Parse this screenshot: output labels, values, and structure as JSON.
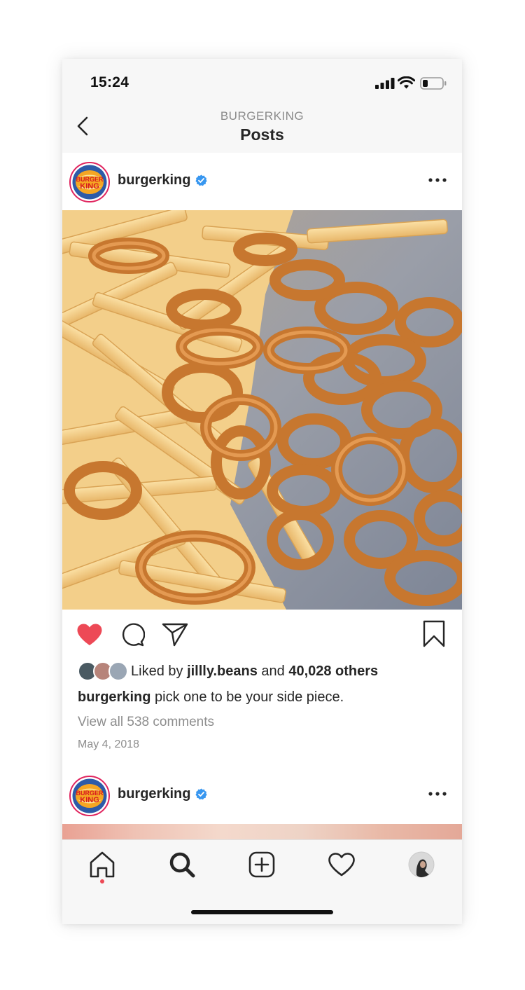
{
  "status_bar": {
    "time": "15:24"
  },
  "nav": {
    "subtitle": "BURGERKING",
    "title": "Posts"
  },
  "post1": {
    "username": "burgerking",
    "verified": true,
    "liked": true,
    "likes": {
      "liked_by_prefix": "Liked by ",
      "liked_by_user": "jillly.beans",
      "and": " and ",
      "others": "40,028 others"
    },
    "caption": {
      "username": "burgerking",
      "text": " pick one to be your side piece."
    },
    "comments_link": "View all 538 comments",
    "date": "May 4, 2018",
    "image_alt": "fries and onion rings"
  },
  "post2": {
    "username": "burgerking",
    "verified": true
  },
  "colors": {
    "like_red": "#ed4956",
    "verified_blue": "#3897f0",
    "bk_blue": "#2d5ba8",
    "bk_red": "#d71920",
    "bk_yellow": "#f5a623"
  },
  "icons": {
    "nav": [
      "chevron-left-icon"
    ],
    "actions": [
      "heart-filled-icon",
      "comment-icon",
      "share-icon",
      "bookmark-icon"
    ],
    "tabs": [
      "home-icon",
      "search-icon",
      "new-post-icon",
      "activity-heart-icon",
      "profile-avatar"
    ]
  }
}
